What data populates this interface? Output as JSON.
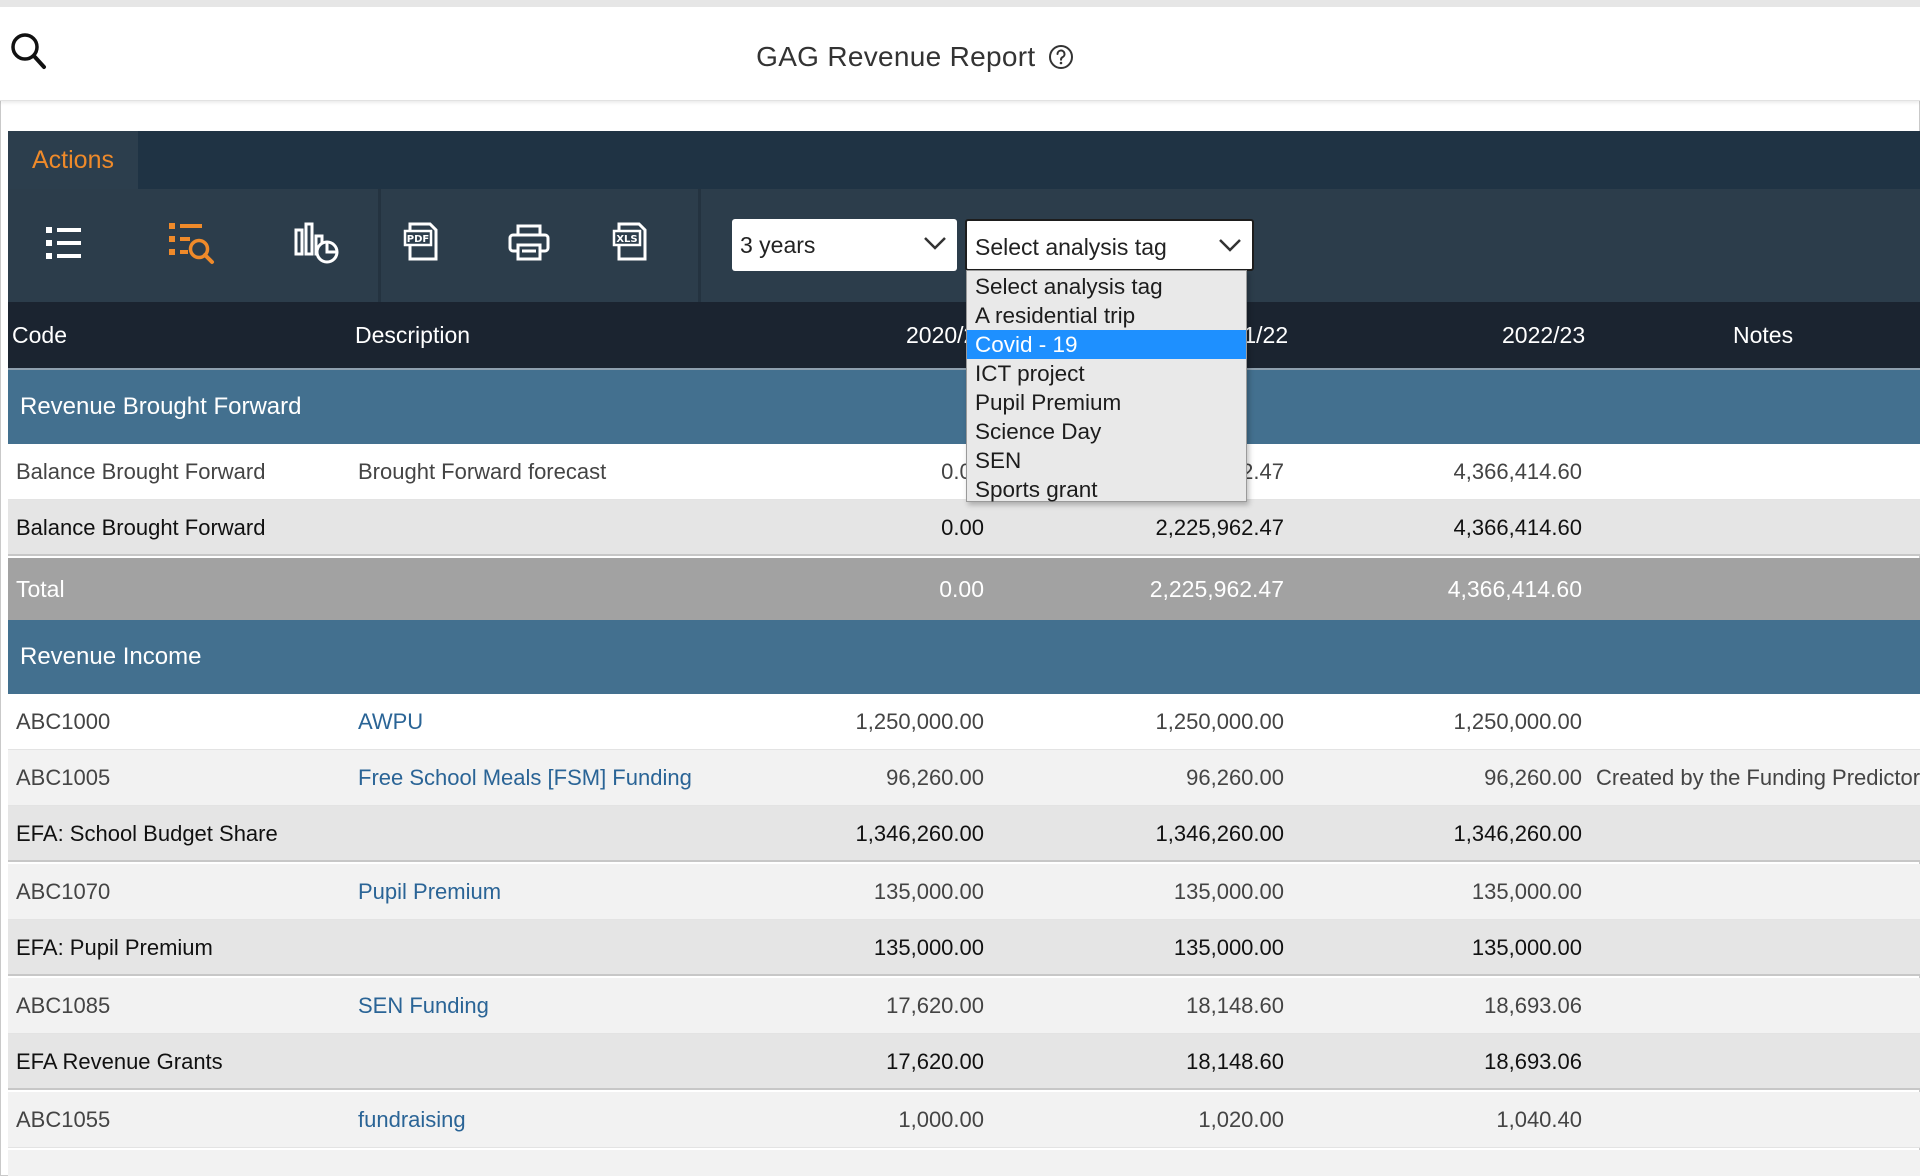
{
  "header": {
    "title": "GAG Revenue Report",
    "search_icon": "search-icon",
    "help_icon": "help-circle-icon"
  },
  "actions": {
    "tab_label": "Actions",
    "accent_color": "#ef8a2a"
  },
  "toolbar": {
    "icons": [
      "list-icon",
      "list-search-icon",
      "chart-icon",
      "pdf-icon",
      "print-icon",
      "xls-icon"
    ],
    "period_select": {
      "value": "3 years"
    },
    "tag_select": {
      "value": "Select analysis tag"
    }
  },
  "dropdown": {
    "options": [
      "Select analysis tag",
      "A residential trip",
      "Covid - 19",
      "ICT project",
      "Pupil Premium",
      "Science Day",
      "SEN",
      "Sports grant"
    ],
    "highlighted": "Covid - 19"
  },
  "table": {
    "headers": {
      "code": "Code",
      "description": "Description",
      "year1": "2020/21",
      "year2": "2021/22",
      "year3": "2022/23",
      "notes": "Notes"
    },
    "sections": [
      {
        "title": "Revenue Brought Forward",
        "rows": [
          {
            "code": "Balance Brought Forward",
            "description": "Brought Forward forecast",
            "y1": "0.00",
            "y2": "2,225,962.47",
            "y3": "4,366,414.60",
            "notes": ""
          },
          {
            "code": "Balance Brought Forward",
            "description": "",
            "y1": "0.00",
            "y2": "2,225,962.47",
            "y3": "4,366,414.60",
            "notes": ""
          }
        ],
        "total": {
          "label": "Total",
          "y1": "0.00",
          "y2": "2,225,962.47",
          "y3": "4,366,414.60"
        }
      },
      {
        "title": "Revenue Income",
        "rows": [
          {
            "code": "ABC1000",
            "description": "AWPU",
            "y1": "1,250,000.00",
            "y2": "1,250,000.00",
            "y3": "1,250,000.00",
            "notes": ""
          },
          {
            "code": "ABC1005",
            "description": "Free School Meals [FSM] Funding",
            "y1": "96,260.00",
            "y2": "96,260.00",
            "y3": "96,260.00",
            "notes": "Created by the Funding Predictor."
          },
          {
            "code": "EFA: School Budget Share",
            "description": "",
            "y1": "1,346,260.00",
            "y2": "1,346,260.00",
            "y3": "1,346,260.00",
            "notes": ""
          },
          {
            "code": "ABC1070",
            "description": "Pupil Premium",
            "y1": "135,000.00",
            "y2": "135,000.00",
            "y3": "135,000.00",
            "notes": ""
          },
          {
            "code": "EFA: Pupil Premium",
            "description": "",
            "y1": "135,000.00",
            "y2": "135,000.00",
            "y3": "135,000.00",
            "notes": ""
          },
          {
            "code": "ABC1085",
            "description": "SEN Funding",
            "y1": "17,620.00",
            "y2": "18,148.60",
            "y3": "18,693.06",
            "notes": ""
          },
          {
            "code": "EFA Revenue Grants",
            "description": "",
            "y1": "17,620.00",
            "y2": "18,148.60",
            "y3": "18,693.06",
            "notes": ""
          },
          {
            "code": "ABC1055",
            "description": "fundraising",
            "y1": "1,000.00",
            "y2": "1,020.00",
            "y3": "1,040.40",
            "notes": ""
          }
        ]
      }
    ]
  }
}
